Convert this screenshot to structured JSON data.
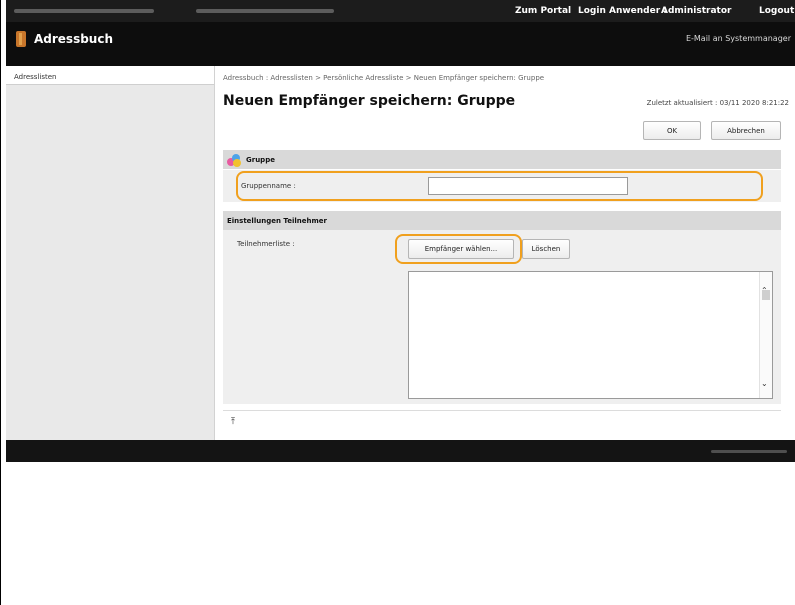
{
  "header": {
    "portal_label": "Zum Portal",
    "login_prefix": "Login Anwender :",
    "login_user": "Administrator",
    "logout_label": "Logout"
  },
  "app": {
    "title": "Adressbuch",
    "mail_link": "E-Mail an Systemmanager"
  },
  "sidebar": {
    "items": [
      {
        "label": "Adresslisten"
      }
    ]
  },
  "main": {
    "breadcrumb": "Adressbuch : Adresslisten > Persönliche Adressliste > Neuen Empfänger speichern: Gruppe",
    "title": "Neuen Empfänger speichern: Gruppe",
    "updated": "Zuletzt aktualisiert : 03/11 2020 8:21:22",
    "ok_label": "OK",
    "cancel_label": "Abbrechen",
    "group_section": {
      "title": "Gruppe",
      "name_label": "Gruppenname :",
      "name_value": ""
    },
    "members_section": {
      "title": "Einstellungen Teilnehmer",
      "list_label": "Teilnehmerliste :",
      "select_label": "Empfänger wählen...",
      "delete_label": "Löschen",
      "members": []
    }
  },
  "colors": {
    "highlight": "#f0a01e",
    "topbar": "#1c1c1c",
    "section_header": "#d9d9d9"
  }
}
